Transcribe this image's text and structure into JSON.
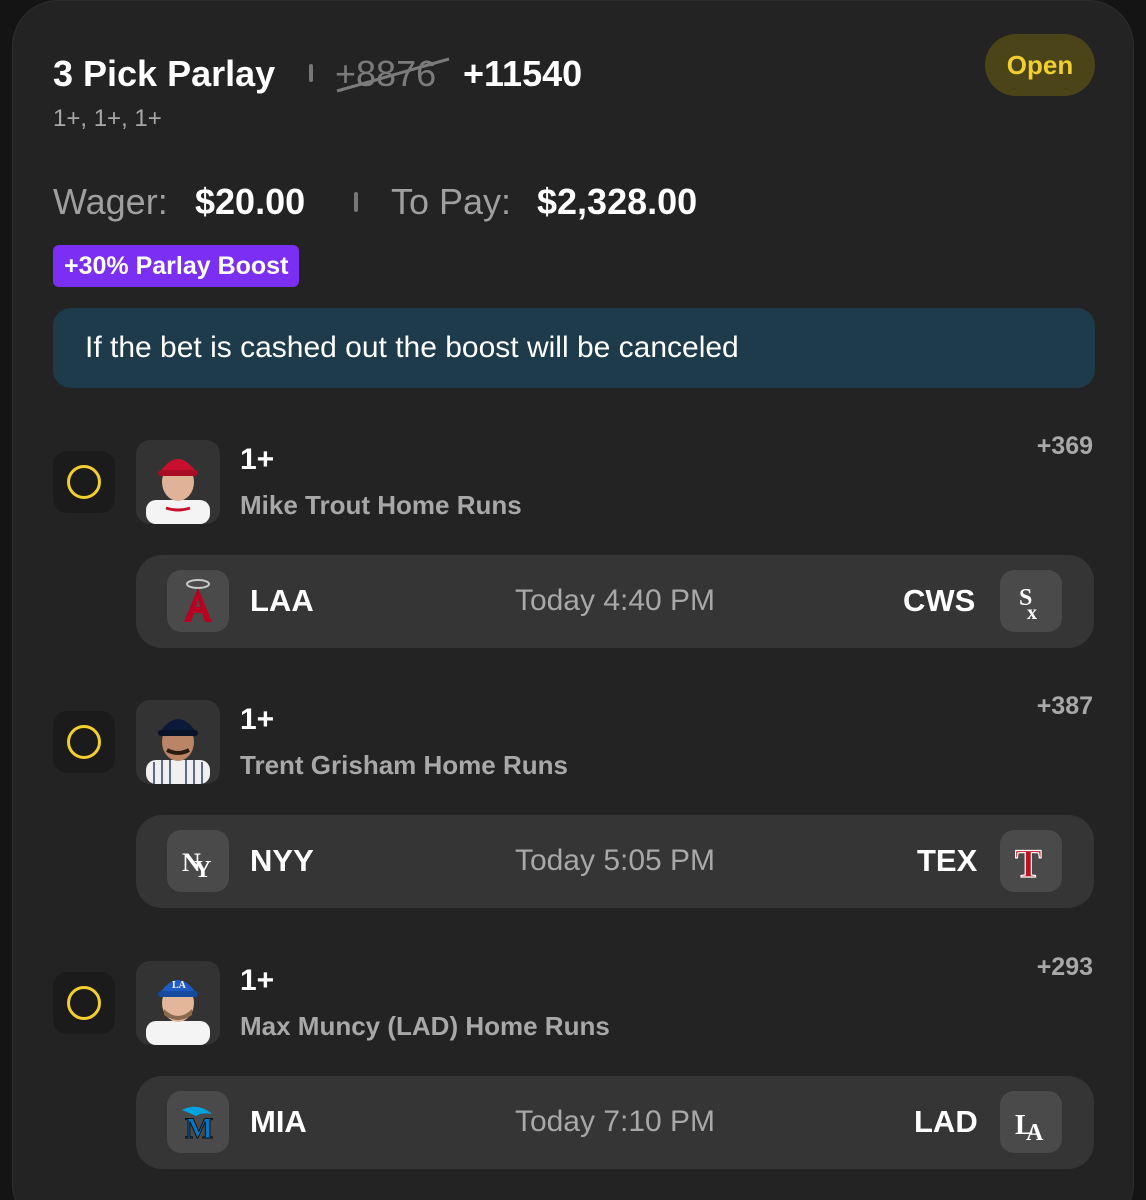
{
  "header": {
    "title": "3 Pick Parlay",
    "original_odds": "+8876",
    "boosted_odds": "+11540",
    "subtitle": "1+, 1+, 1+",
    "status": "Open"
  },
  "wager": {
    "wager_label": "Wager:",
    "wager_value": "$20.00",
    "pay_label": "To Pay:",
    "pay_value": "$2,328.00"
  },
  "boost": {
    "badge": "+30% Parlay Boost",
    "notice": "If the bet is cashed out the boost will be canceled"
  },
  "legs": [
    {
      "line": "1+",
      "market": "Mike Trout Home Runs",
      "odds": "+369",
      "away_team": "LAA",
      "home_team": "CWS",
      "game_time": "Today 4:40 PM",
      "away_logo_icon": "angels-logo-icon",
      "home_logo_icon": "white-sox-logo-icon"
    },
    {
      "line": "1+",
      "market": "Trent Grisham Home Runs",
      "odds": "+387",
      "away_team": "NYY",
      "home_team": "TEX",
      "game_time": "Today 5:05 PM",
      "away_logo_icon": "yankees-logo-icon",
      "home_logo_icon": "rangers-logo-icon"
    },
    {
      "line": "1+",
      "market": "Max Muncy (LAD) Home Runs",
      "odds": "+293",
      "away_team": "MIA",
      "home_team": "LAD",
      "game_time": "Today 7:10 PM",
      "away_logo_icon": "marlins-logo-icon",
      "home_logo_icon": "dodgers-logo-icon"
    }
  ],
  "colors": {
    "background": "#141414",
    "card": "#232323",
    "accent_yellow": "#f2cf2e",
    "boost_purple": "#7b2ff2",
    "notice_blue": "#1d3b4b"
  }
}
